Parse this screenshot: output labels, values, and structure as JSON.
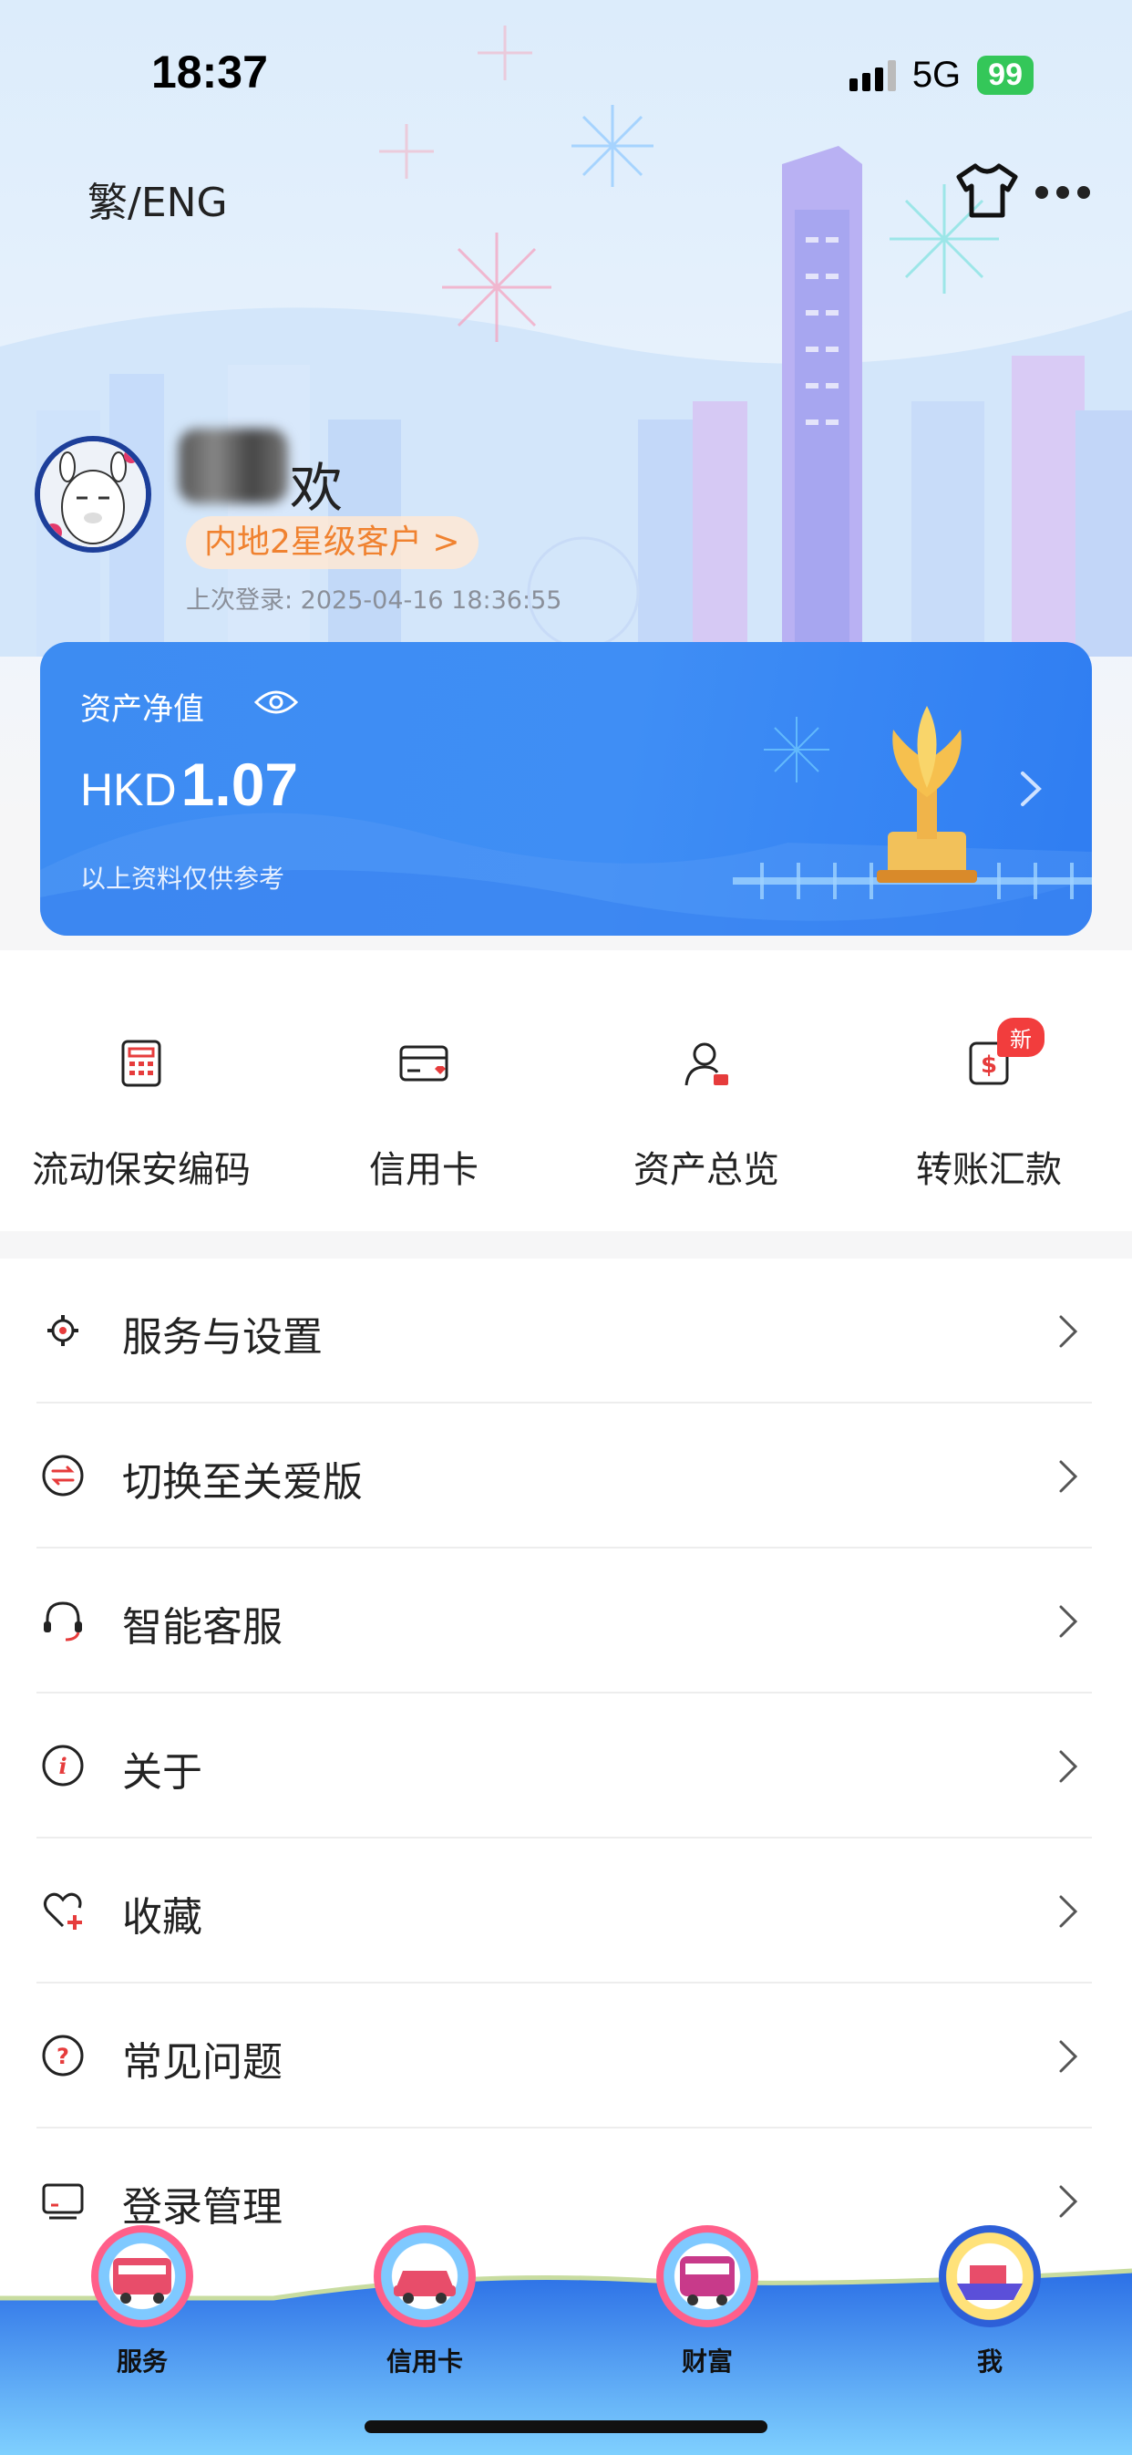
{
  "status_bar": {
    "time": "18:37",
    "network": "5G",
    "battery": "99"
  },
  "header": {
    "lang_toggle": "繁/ENG",
    "theme_icon": "shirt-icon",
    "more_icon": "more-icon"
  },
  "profile": {
    "username_suffix": "欢",
    "tier": "内地2星级客户 >",
    "last_login": "上次登录: 2025-04-16 18:36:55"
  },
  "asset_card": {
    "title": "资产净值",
    "currency": "HKD",
    "amount": "1.07",
    "note": "以上资料仅供参考"
  },
  "quick_actions": [
    {
      "label": "流动保安编码",
      "icon": "security-code-icon"
    },
    {
      "label": "信用卡",
      "icon": "credit-card-icon"
    },
    {
      "label": "资产总览",
      "icon": "asset-overview-icon"
    },
    {
      "label": "转账汇款",
      "icon": "transfer-icon",
      "badge": "新"
    }
  ],
  "menu": [
    {
      "label": "服务与设置",
      "icon": "gear-icon"
    },
    {
      "label": "切换至关爱版",
      "icon": "switch-icon"
    },
    {
      "label": "智能客服",
      "icon": "headset-icon"
    },
    {
      "label": "关于",
      "icon": "info-icon"
    },
    {
      "label": "收藏",
      "icon": "heart-plus-icon"
    },
    {
      "label": "常见问题",
      "icon": "question-icon"
    },
    {
      "label": "登录管理",
      "icon": "monitor-icon"
    }
  ],
  "tabs": [
    {
      "label": "服务",
      "icon": "bus-icon"
    },
    {
      "label": "信用卡",
      "icon": "taxi-icon"
    },
    {
      "label": "财富",
      "icon": "tram-icon"
    },
    {
      "label": "我",
      "icon": "ferry-icon"
    }
  ],
  "colors": {
    "accent_blue": "#3d8cf2",
    "accent_orange": "#f08230",
    "accent_red": "#f23d3d",
    "battery_green": "#34c759"
  }
}
